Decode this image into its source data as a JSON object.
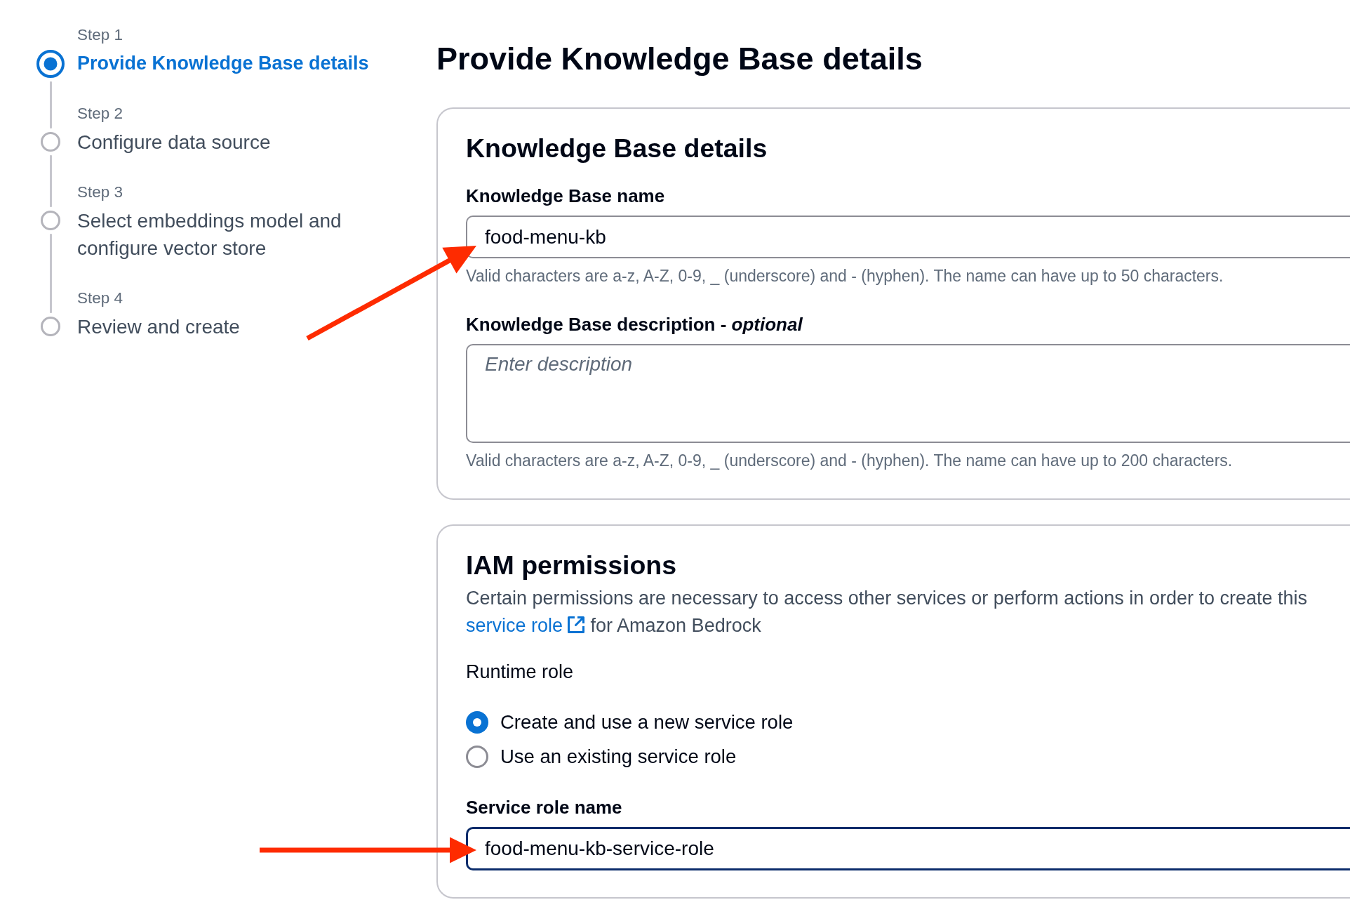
{
  "steps": [
    {
      "step_label": "Step 1",
      "title": "Provide Knowledge Base details",
      "selected": true
    },
    {
      "step_label": "Step 2",
      "title": "Configure data source",
      "selected": false
    },
    {
      "step_label": "Step 3",
      "title": "Select embeddings model and configure vector store",
      "selected": false
    },
    {
      "step_label": "Step 4",
      "title": "Review and create",
      "selected": false
    }
  ],
  "page_title": "Provide Knowledge Base details",
  "sections": [
    {
      "title": "Knowledge Base details",
      "fields": [
        {
          "kind": "text",
          "label": "Knowledge Base name",
          "value": "food-menu-kb",
          "focused": false,
          "arrow": {
            "kind": "diagonal"
          },
          "hint": "Valid characters are a-z, A-Z, 0-9, _ (underscore) and - (hyphen). The name can have up to 50 characters."
        },
        {
          "kind": "textarea",
          "label": "Knowledge Base description - *optional*",
          "placeholder": "Enter description",
          "focused": false,
          "hint": "Valid characters are a-z, A-Z, 0-9, _ (underscore) and - (hyphen). The name can have up to 200 characters."
        }
      ]
    },
    {
      "title": "IAM permissions",
      "description": {
        "text": "Certain permissions are necessary to access other services or perform actions in order to create this",
        "link": "service role",
        "text_after": "for Amazon Bedrock"
      },
      "fields": [
        {
          "kind": "radio",
          "label": "Runtime role",
          "options": [
            {
              "label": "Create and use a new service role",
              "selected": true
            },
            {
              "label": "Use an existing service role",
              "selected": false
            }
          ]
        },
        {
          "kind": "text",
          "label": "Service role name",
          "value": "food-menu-kb-service-role",
          "focused": true,
          "arrow": {
            "kind": "straight"
          }
        }
      ]
    }
  ]
}
